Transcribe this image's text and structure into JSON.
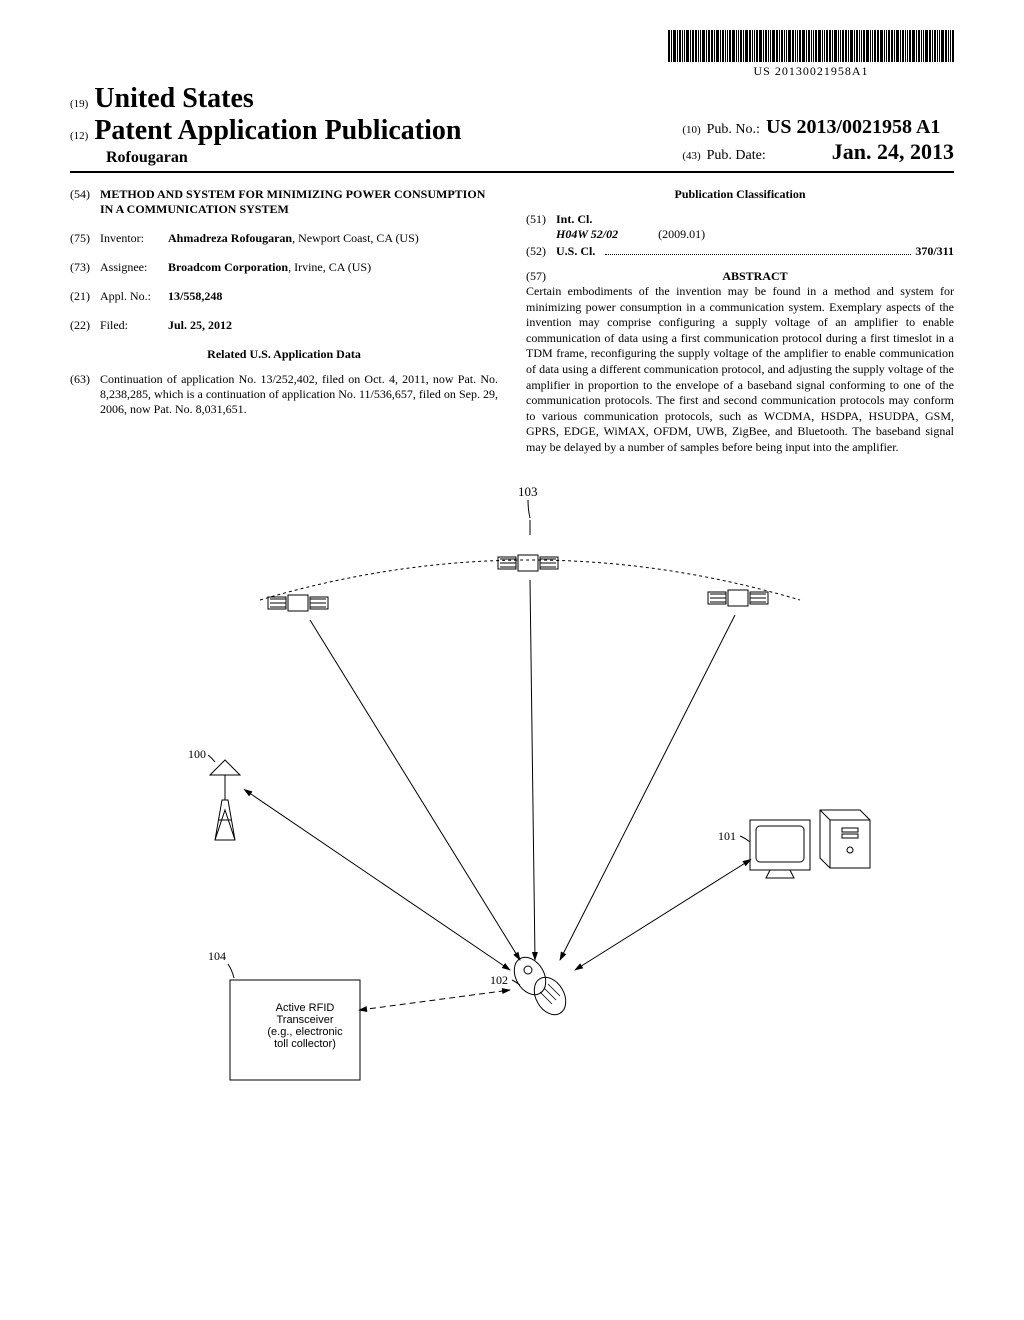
{
  "barcode_number": "US 20130021958A1",
  "header": {
    "code19": "(19)",
    "country": "United States",
    "code12": "(12)",
    "pub_type": "Patent Application Publication",
    "author": "Rofougaran",
    "code10": "(10)",
    "pubno_label": "Pub. No.:",
    "pubno": "US 2013/0021958 A1",
    "code43": "(43)",
    "pubdate_label": "Pub. Date:",
    "pubdate": "Jan. 24, 2013"
  },
  "left": {
    "code54": "(54)",
    "title": "METHOD AND SYSTEM FOR MINIMIZING POWER CONSUMPTION IN A COMMUNICATION SYSTEM",
    "code75": "(75)",
    "inventor_label": "Inventor:",
    "inventor": "Ahmadreza Rofougaran",
    "inventor_loc": ", Newport Coast, CA (US)",
    "code73": "(73)",
    "assignee_label": "Assignee:",
    "assignee": "Broadcom Corporation",
    "assignee_loc": ", Irvine, CA (US)",
    "code21": "(21)",
    "appl_label": "Appl. No.:",
    "appl_no": "13/558,248",
    "code22": "(22)",
    "filed_label": "Filed:",
    "filed": "Jul. 25, 2012",
    "related_head": "Related U.S. Application Data",
    "code63": "(63)",
    "related_text": "Continuation of application No. 13/252,402, filed on Oct. 4, 2011, now Pat. No. 8,238,285, which is a continuation of application No. 11/536,657, filed on Sep. 29, 2006, now Pat. No. 8,031,651."
  },
  "right": {
    "class_head": "Publication Classification",
    "code51": "(51)",
    "intcl_label": "Int. Cl.",
    "intcl_val": "H04W 52/02",
    "intcl_date": "(2009.01)",
    "code52": "(52)",
    "uscl_label": "U.S. Cl.",
    "uscl_val": "370/311",
    "code57": "(57)",
    "abstract_head": "ABSTRACT",
    "abstract": "Certain embodiments of the invention may be found in a method and system for minimizing power consumption in a communication system. Exemplary aspects of the invention may comprise configuring a supply voltage of an amplifier to enable communication of data using a first communication protocol during a first timeslot in a TDM frame, reconfiguring the supply voltage of the amplifier to enable communication of data using a different communication protocol, and adjusting the supply voltage of the amplifier in proportion to the envelope of a baseband signal conforming to one of the communication protocols. The first and second communication protocols may conform to various communication protocols, such as WCDMA, HSDPA, HSUDPA, GSM, GPRS, EDGE, WiMAX, OFDM, UWB, ZigBee, and Bluetooth. The baseband signal may be delayed by a number of samples before being input into the amplifier."
  },
  "figure": {
    "ref103": "103",
    "ref100": "100",
    "ref101": "101",
    "ref102": "102",
    "ref104": "104",
    "box_line1": "Active RFID",
    "box_line2": "Transceiver",
    "box_line3": "(e.g., electronic",
    "box_line4": "toll collector)"
  }
}
